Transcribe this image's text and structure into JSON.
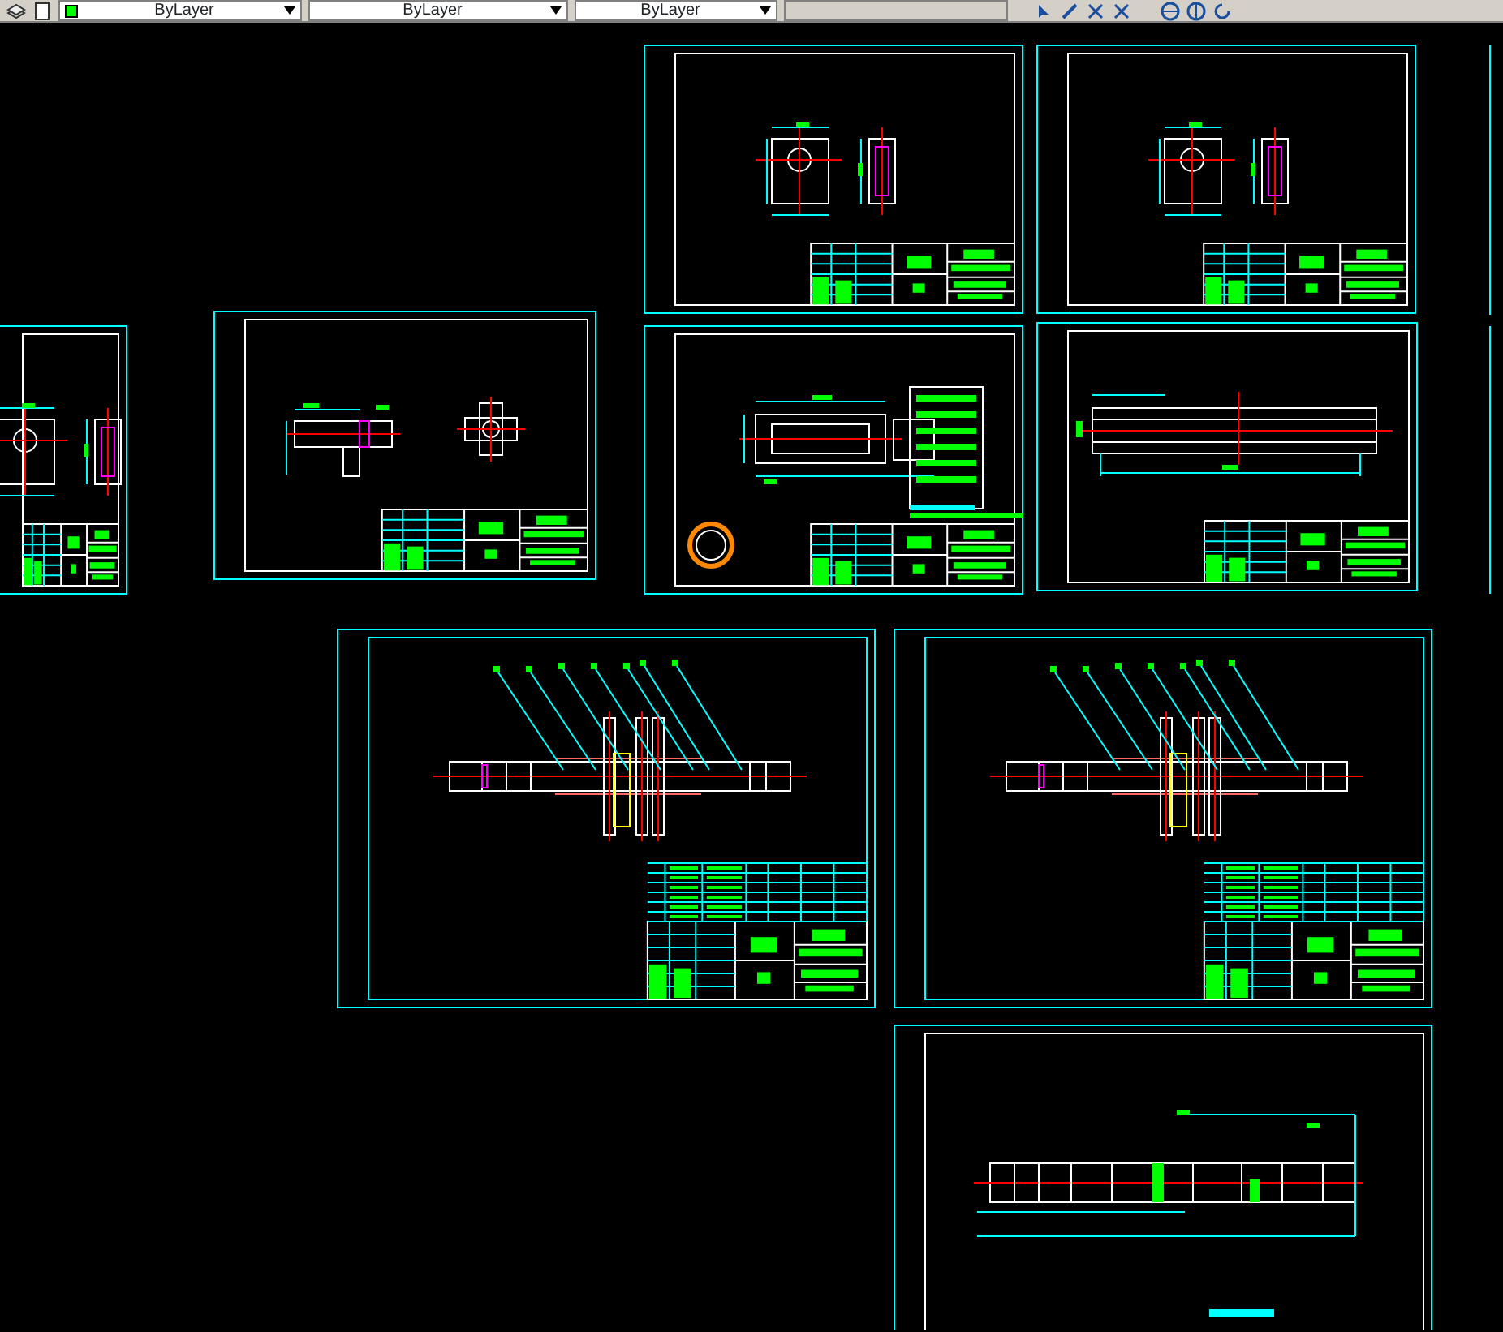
{
  "toolbar": {
    "dropdowns": [
      {
        "value": "ByLayer",
        "color": "#00ff00"
      },
      {
        "value": "ByLayer"
      },
      {
        "value": "ByLayer"
      }
    ]
  },
  "sheets": [
    {
      "kind": "bracket",
      "title_block": true
    },
    {
      "kind": "bracket",
      "title_block": true
    },
    {
      "kind": "bracket",
      "title_block": true
    },
    {
      "kind": "fork",
      "title_block": true
    },
    {
      "kind": "sleeve",
      "title_block": true
    },
    {
      "kind": "tube",
      "title_block": true
    },
    {
      "kind": "assembly",
      "title_block": true
    },
    {
      "kind": "assembly",
      "title_block": true
    },
    {
      "kind": "shaft",
      "title_block": false
    }
  ]
}
